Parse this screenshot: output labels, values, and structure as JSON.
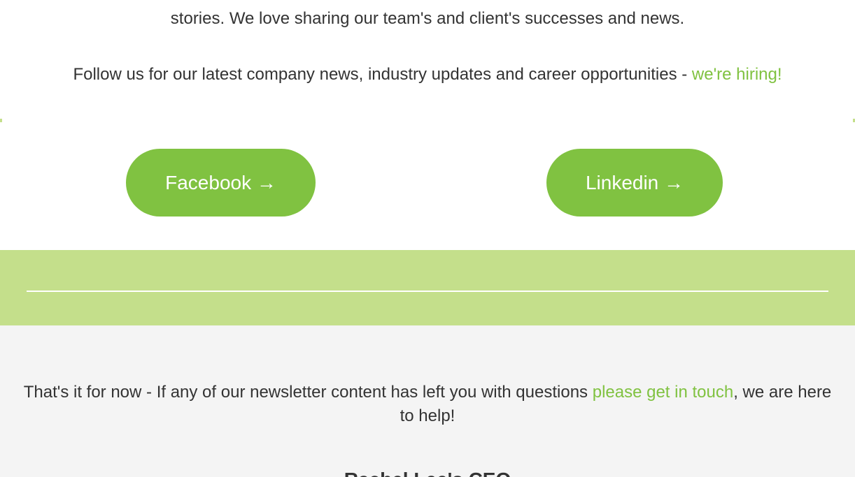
{
  "intro": {
    "line1": "stories. We love sharing our team's and client's successes and news.",
    "line2_text": "Follow us for our latest company news, industry updates and career opportunities - ",
    "line2_link": "we're hiring!"
  },
  "social": {
    "facebook_label": "Facebook →",
    "linkedin_label": "Linkedin →"
  },
  "footer": {
    "text_before_link": "That's it for now - If any of our newsletter content has left you with questions ",
    "link": "please get in touch",
    "text_after_link": ", we are here to help!",
    "heading_partial": "Rachel Lee's CEO"
  },
  "colors": {
    "accent_green": "#80c241",
    "band_green": "#c4df8b",
    "footer_bg": "#f4f4f4",
    "text": "#333333"
  }
}
